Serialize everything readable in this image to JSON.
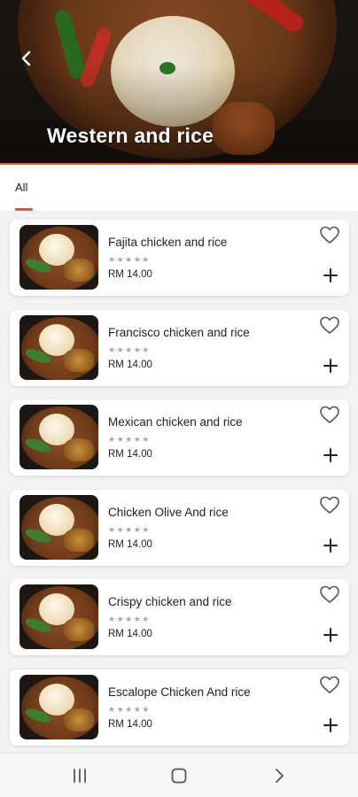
{
  "header": {
    "title": "Western and rice",
    "back_icon": "chevron-left-icon"
  },
  "tabs": [
    {
      "label": "All",
      "active": true
    }
  ],
  "accent_color": "#e5552c",
  "items": [
    {
      "name": "Fajita chicken and rice",
      "stars": "★★★★★",
      "price": "RM 14.00"
    },
    {
      "name": "Francisco chicken and rice",
      "stars": "★★★★★",
      "price": "RM 14.00"
    },
    {
      "name": "Mexican chicken and rice",
      "stars": "★★★★★",
      "price": "RM 14.00"
    },
    {
      "name": "Chicken Olive And rice",
      "stars": "★★★★★",
      "price": "RM 14.00"
    },
    {
      "name": "Crispy chicken and rice",
      "stars": "★★★★★",
      "price": "RM 14.00"
    },
    {
      "name": "Escalope Chicken And rice",
      "stars": "★★★★★",
      "price": "RM 14.00"
    }
  ],
  "nav": {
    "recents_icon": "recents-icon",
    "home_icon": "home-icon",
    "back_icon": "back-arrow-icon"
  }
}
